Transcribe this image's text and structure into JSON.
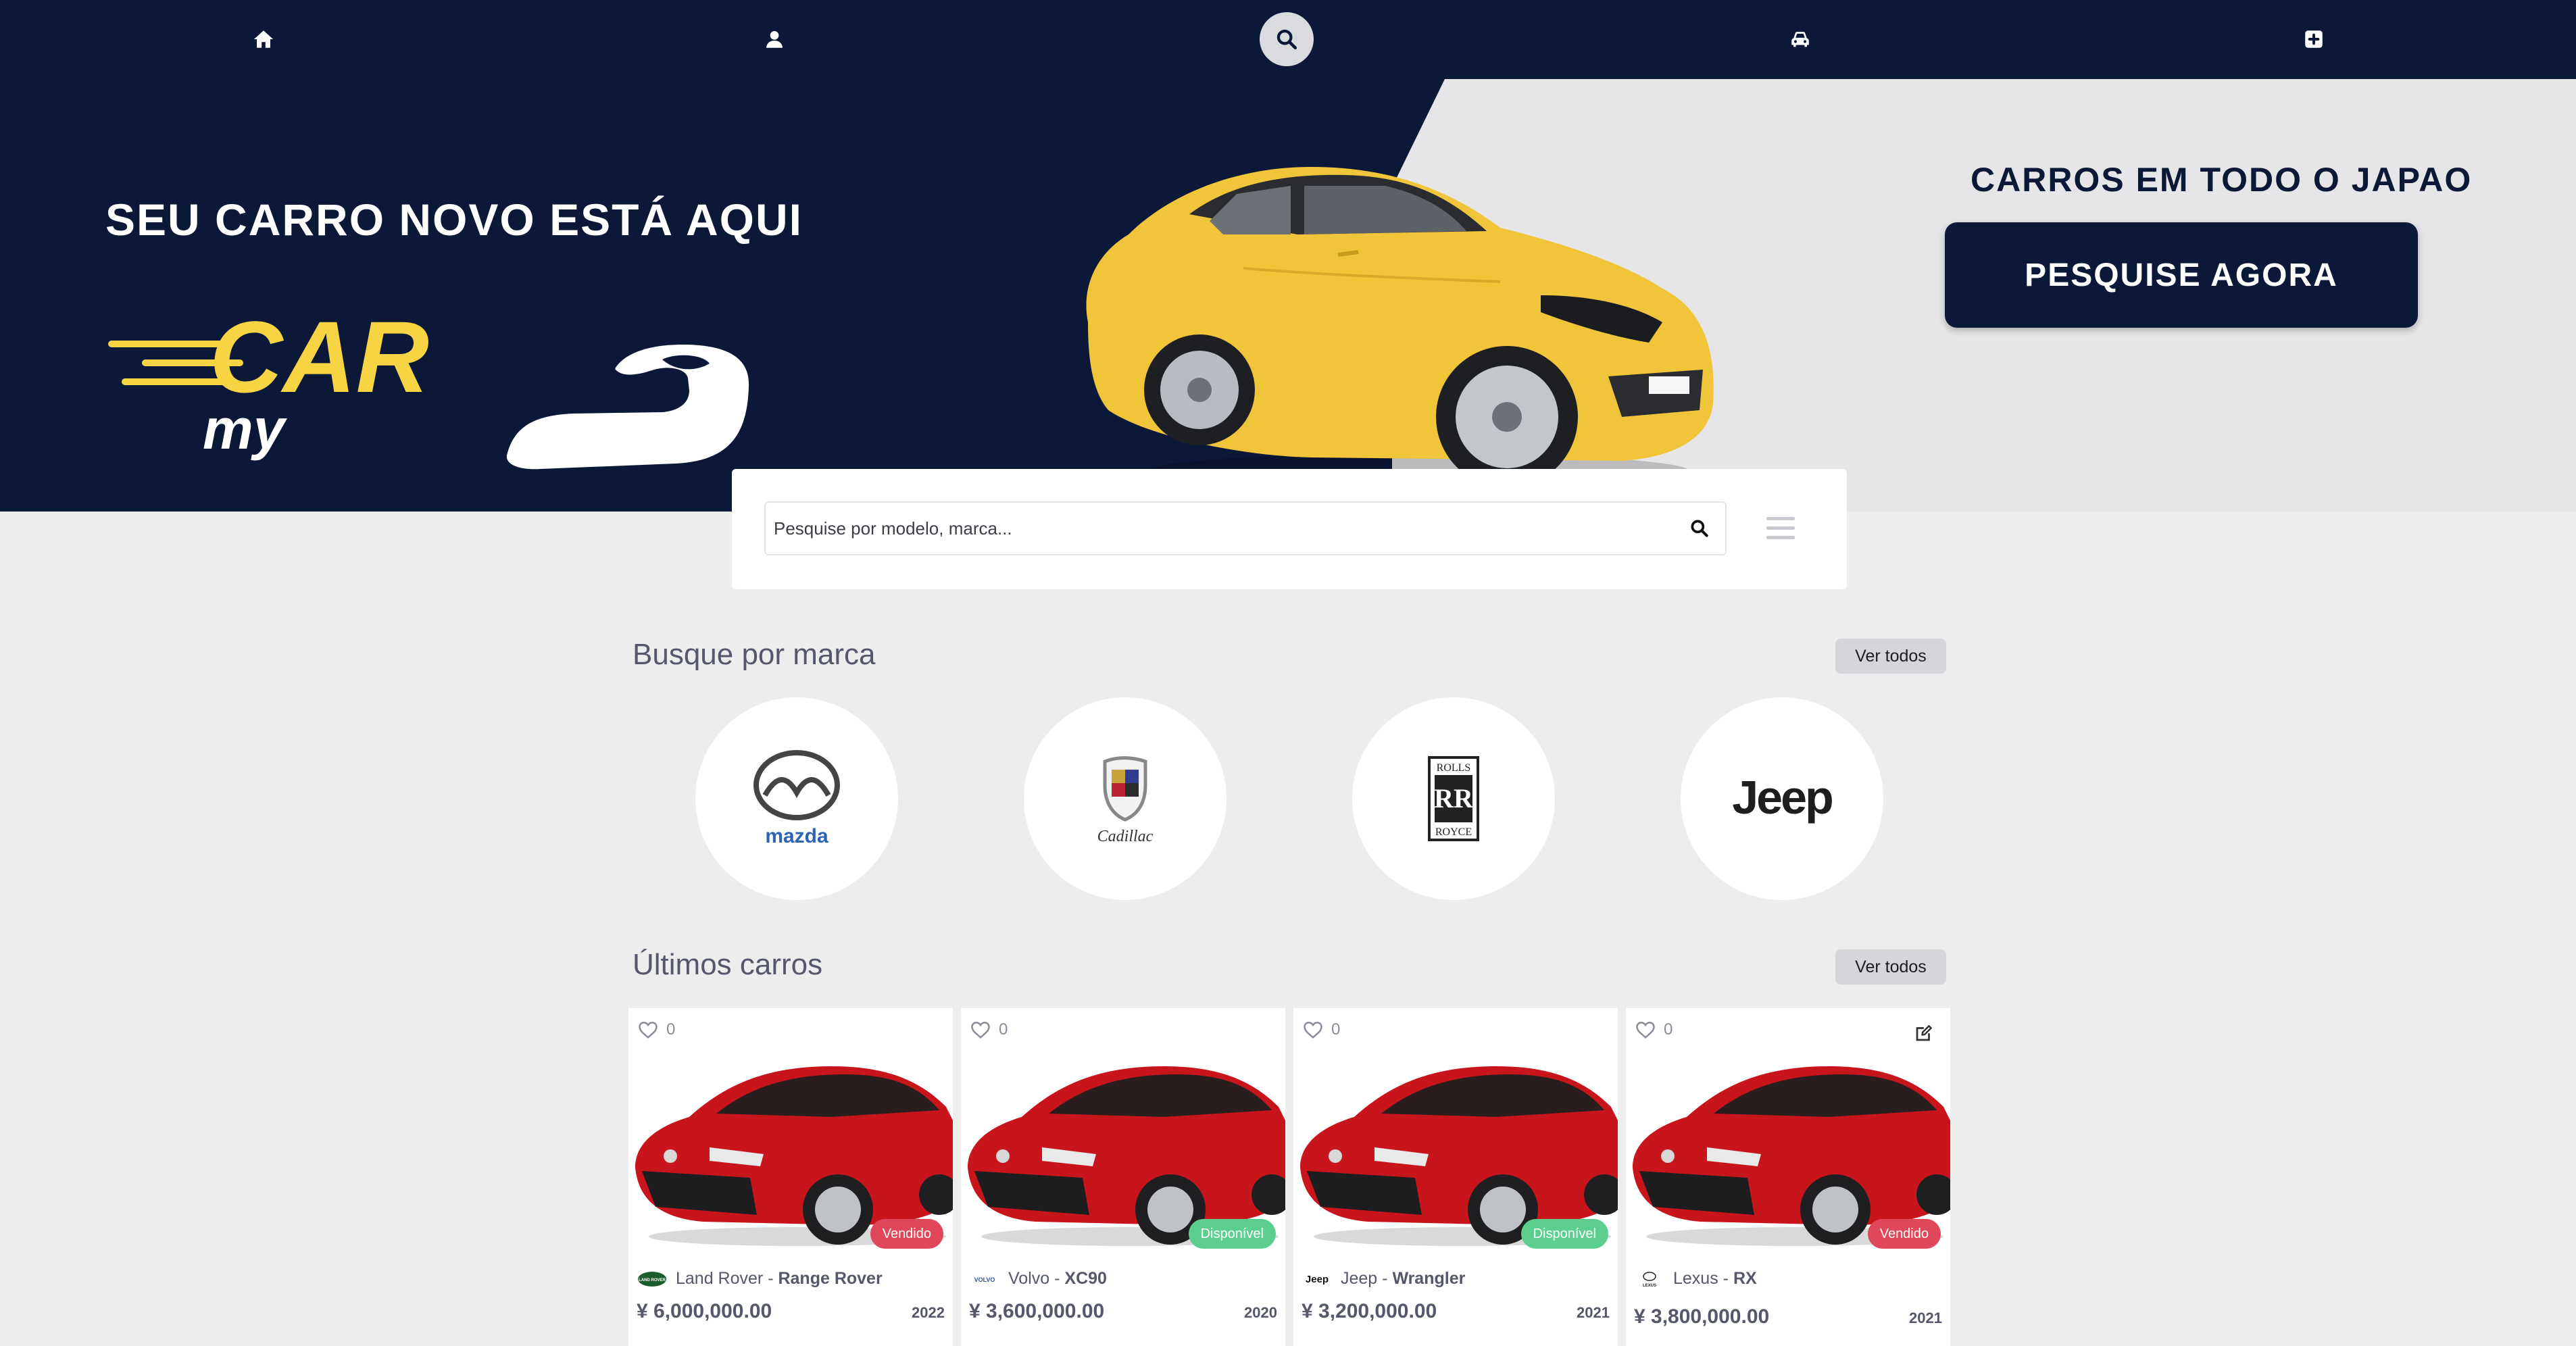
{
  "nav": {
    "items": [
      {
        "icon": "home-icon"
      },
      {
        "icon": "user-icon"
      },
      {
        "icon": "search-icon",
        "active": true
      },
      {
        "icon": "car-icon"
      },
      {
        "icon": "plus-square-icon"
      }
    ]
  },
  "hero": {
    "tagline": "SEU CARRO NOVO ESTÁ AQUI",
    "logo_text_big": "CAR",
    "logo_text_small": "my",
    "cta_title_prefix": "CARROS EM ",
    "cta_title_bold": "TODO O JAPAO",
    "cta_button": "PESQUISE AGORA",
    "colors": {
      "navy": "#0b1838",
      "yellow": "#f7d443",
      "light": "#e6e6e8"
    }
  },
  "search": {
    "placeholder": "Pesquise por modelo, marca...",
    "value": ""
  },
  "brands_section": {
    "title": "Busque por marca",
    "see_all": "Ver todos",
    "brands": [
      {
        "name": "Mazda",
        "label": "mazda"
      },
      {
        "name": "Cadillac",
        "label": "Cadillac"
      },
      {
        "name": "Rolls-Royce",
        "label_top": "ROLLS",
        "label_bottom": "ROYCE",
        "monogram": "RR"
      },
      {
        "name": "Jeep",
        "label": "Jeep"
      }
    ]
  },
  "cars_section": {
    "title": "Últimos carros",
    "see_all": "Ver todos",
    "cars": [
      {
        "likes": "0",
        "brand": "Land Rover",
        "separator": " - ",
        "model": "Range Rover",
        "price": "¥ 6,000,000.00",
        "year": "2022",
        "status": "Vendido",
        "status_color": "#e0475a",
        "brand_logo_text": "LAND ROVER"
      },
      {
        "likes": "0",
        "brand": "Volvo",
        "separator": " - ",
        "model": "XC90",
        "price": "¥ 3,600,000.00",
        "year": "2020",
        "status": "Disponível",
        "status_color": "#5ccf8e",
        "brand_logo_text": "VOLVO"
      },
      {
        "likes": "0",
        "brand": "Jeep",
        "separator": " - ",
        "model": "Wrangler",
        "price": "¥ 3,200,000.00",
        "year": "2021",
        "status": "Disponível",
        "status_color": "#5ccf8e",
        "brand_logo_text": "Jeep"
      },
      {
        "likes": "0",
        "brand": "Lexus",
        "separator": " - ",
        "model": "RX",
        "price": "¥ 3,800,000.00",
        "year": "2021",
        "status": "Vendido",
        "status_color": "#e0475a",
        "brand_logo_text": "LEXUS",
        "editable": true
      }
    ]
  }
}
